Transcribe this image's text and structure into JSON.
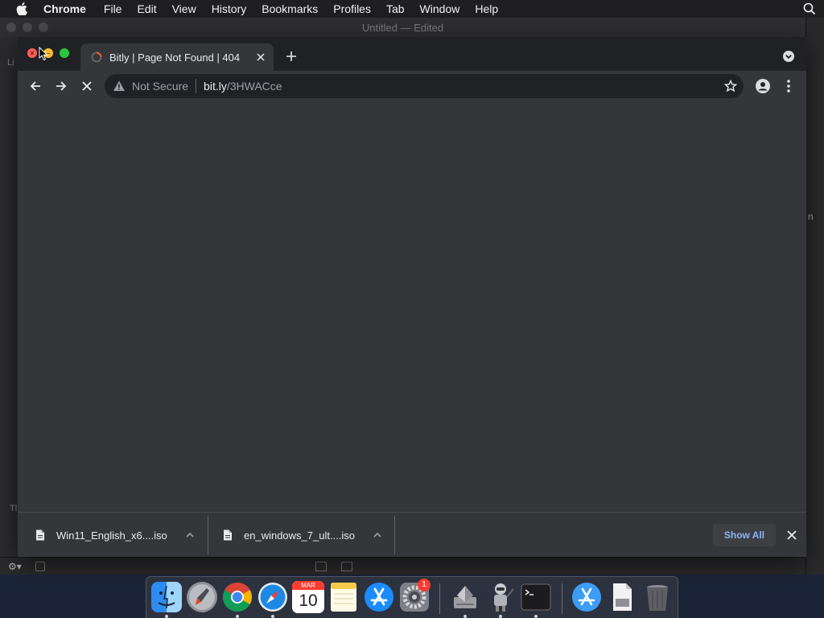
{
  "menubar": {
    "app_name": "Chrome",
    "items": [
      "File",
      "Edit",
      "View",
      "History",
      "Bookmarks",
      "Profiles",
      "Tab",
      "Window",
      "Help"
    ]
  },
  "background_window": {
    "title": "Untitled — Edited",
    "side_text_1": "Li",
    "side_text_2": "Tl",
    "right_text": "n"
  },
  "browser": {
    "tab": {
      "title": "Bitly | Page Not Found | 404"
    },
    "omnibox": {
      "security_label": "Not Secure",
      "url_host": "bit.ly",
      "url_path": "/3HWACce"
    }
  },
  "downloads": {
    "items": [
      {
        "filename": "Win11_English_x6....iso"
      },
      {
        "filename": "en_windows_7_ult....iso"
      }
    ],
    "show_all_label": "Show All"
  },
  "dock": {
    "calendar": {
      "month": "MAR",
      "day": "10"
    },
    "settings_badge": "1"
  },
  "colors": {
    "chrome_dark": "#35363a",
    "tabstrip": "#202124",
    "link_blue": "#8ab4f8"
  }
}
